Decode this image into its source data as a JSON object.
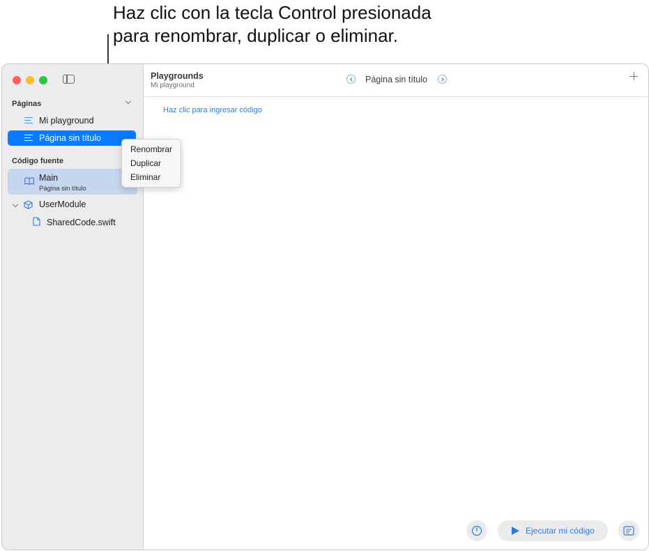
{
  "callout": {
    "line1": "Haz clic con la tecla Control presionada",
    "line2": "para renombrar, duplicar o eliminar."
  },
  "sidebar": {
    "pages_section": "Páginas",
    "pages": [
      {
        "label": "Mi playground",
        "selected": false
      },
      {
        "label": "Página sin título",
        "selected": true
      }
    ],
    "source_section": "Código fuente",
    "main_file": {
      "title": "Main",
      "subtitle": "Página sin título"
    },
    "module": {
      "label": "UserModule",
      "icon": "cube-icon"
    },
    "module_file": {
      "label": "SharedCode.swift",
      "icon": "document-icon"
    }
  },
  "context_menu": {
    "items": [
      "Renombrar",
      "Duplicar",
      "Eliminar"
    ]
  },
  "toolbar": {
    "title": "Playgrounds",
    "subtitle": "Mi playground",
    "current_page": "Página sin título"
  },
  "editor": {
    "hint": "Haz clic para ingresar código"
  },
  "bottom_bar": {
    "run_label": "Ejecutar mi código"
  },
  "colors": {
    "accent": "#0a7aff",
    "link": "#2f7bd8",
    "sidebar_bg": "#ececee",
    "selected_source_bg": "#c7d6ef"
  }
}
